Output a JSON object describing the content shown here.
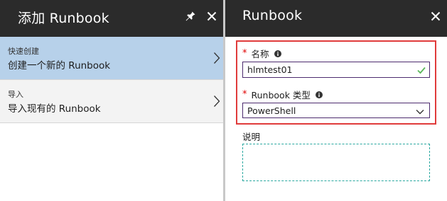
{
  "left_blade": {
    "title": "添加 Runbook",
    "items": [
      {
        "subtitle": "快速创建",
        "label": "创建一个新的 Runbook",
        "selected": true
      },
      {
        "subtitle": "导入",
        "label": "导入现有的 Runbook",
        "selected": false
      }
    ]
  },
  "right_blade": {
    "title": "Runbook",
    "name_field": {
      "label": "名称",
      "value": "hlmtest01",
      "required": true
    },
    "type_field": {
      "label": "Runbook 类型",
      "value": "PowerShell",
      "required": true
    },
    "description_field": {
      "label": "说明",
      "value": ""
    }
  },
  "colors": {
    "header_bg": "#2b2b2b",
    "selected_bg": "#b7d1ea",
    "highlight_border": "#e03b3b",
    "required_star": "#e00000",
    "valid_check": "#5cb85c",
    "input_border": "#4c2a6e",
    "description_border": "#2aa8a0"
  },
  "icons": {
    "pin": "pin-icon",
    "close": "close-icon",
    "chevron": "chevron-right-icon",
    "info": "info-icon",
    "check": "check-icon",
    "dropdown": "chevron-down-icon"
  }
}
